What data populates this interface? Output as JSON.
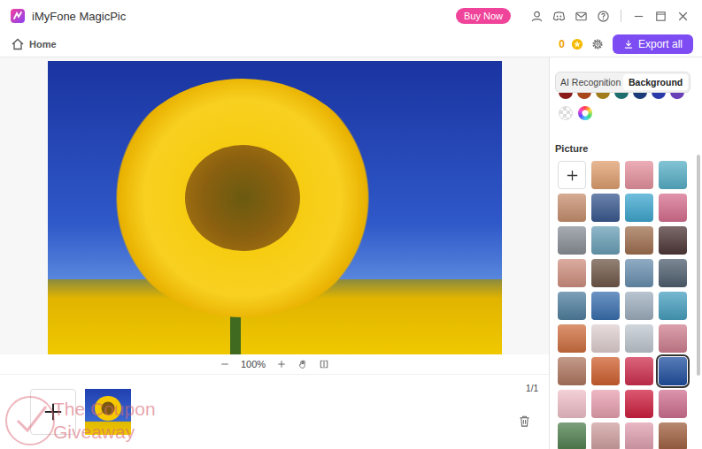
{
  "window": {
    "title": "iMyFone MagicPic"
  },
  "header": {
    "buy_button": "Buy Now"
  },
  "toolbar": {
    "home": "Home",
    "credits": "0",
    "export_button": "Export all"
  },
  "canvas": {
    "zoom": "100%"
  },
  "filmstrip": {
    "counter": "1/1"
  },
  "panel": {
    "tabs": [
      {
        "label": "AI Recognition",
        "selected": false
      },
      {
        "label": "Background",
        "selected": true
      }
    ],
    "swatches": [
      {
        "color": "#8b1a1a"
      },
      {
        "color": "#a8461c"
      },
      {
        "color": "#a07c1c"
      },
      {
        "color": "#1f6e6e"
      },
      {
        "color": "#1c3a78"
      },
      {
        "color": "#2a3aa8"
      },
      {
        "color": "#6a40b8"
      }
    ],
    "section": "Picture",
    "pictures": [
      {
        "color": "#e0a070",
        "selected": false
      },
      {
        "color": "#e6929e",
        "selected": false
      },
      {
        "color": "#58b0c8",
        "selected": false
      },
      {
        "color": "#c89070",
        "selected": false
      },
      {
        "color": "#3a5a90",
        "selected": false
      },
      {
        "color": "#40a8d0",
        "selected": false
      },
      {
        "color": "#d87090",
        "selected": false
      },
      {
        "color": "#8a9098",
        "selected": false
      },
      {
        "color": "#6aa0b8",
        "selected": false
      },
      {
        "color": "#a07050",
        "selected": false
      },
      {
        "color": "#503838",
        "selected": false
      },
      {
        "color": "#d09080",
        "selected": false
      },
      {
        "color": "#705848",
        "selected": false
      },
      {
        "color": "#6a90b0",
        "selected": false
      },
      {
        "color": "#506070",
        "selected": false
      },
      {
        "color": "#5080a0",
        "selected": false
      },
      {
        "color": "#3a70b0",
        "selected": false
      },
      {
        "color": "#a0b0c0",
        "selected": false
      },
      {
        "color": "#48a0c0",
        "selected": false
      },
      {
        "color": "#d07040",
        "selected": false
      },
      {
        "color": "#e0d0d0",
        "selected": false
      },
      {
        "color": "#c0c8d0",
        "selected": false
      },
      {
        "color": "#d08090",
        "selected": false
      },
      {
        "color": "#b07860",
        "selected": false
      },
      {
        "color": "#d06030",
        "selected": false
      },
      {
        "color": "#d03050",
        "selected": false
      },
      {
        "color": "#2050a0",
        "selected": true
      },
      {
        "color": "#f0c0c8",
        "selected": false
      },
      {
        "color": "#e8a0b0",
        "selected": false
      },
      {
        "color": "#d02040",
        "selected": false
      },
      {
        "color": "#d07090",
        "selected": false
      },
      {
        "color": "#508050",
        "selected": false
      },
      {
        "color": "#d0a0a0",
        "selected": false
      },
      {
        "color": "#e0a0b0",
        "selected": false
      },
      {
        "color": "#a06040",
        "selected": false
      }
    ]
  },
  "watermark": {
    "lines": [
      "The Coupon",
      "Giveaway"
    ]
  }
}
